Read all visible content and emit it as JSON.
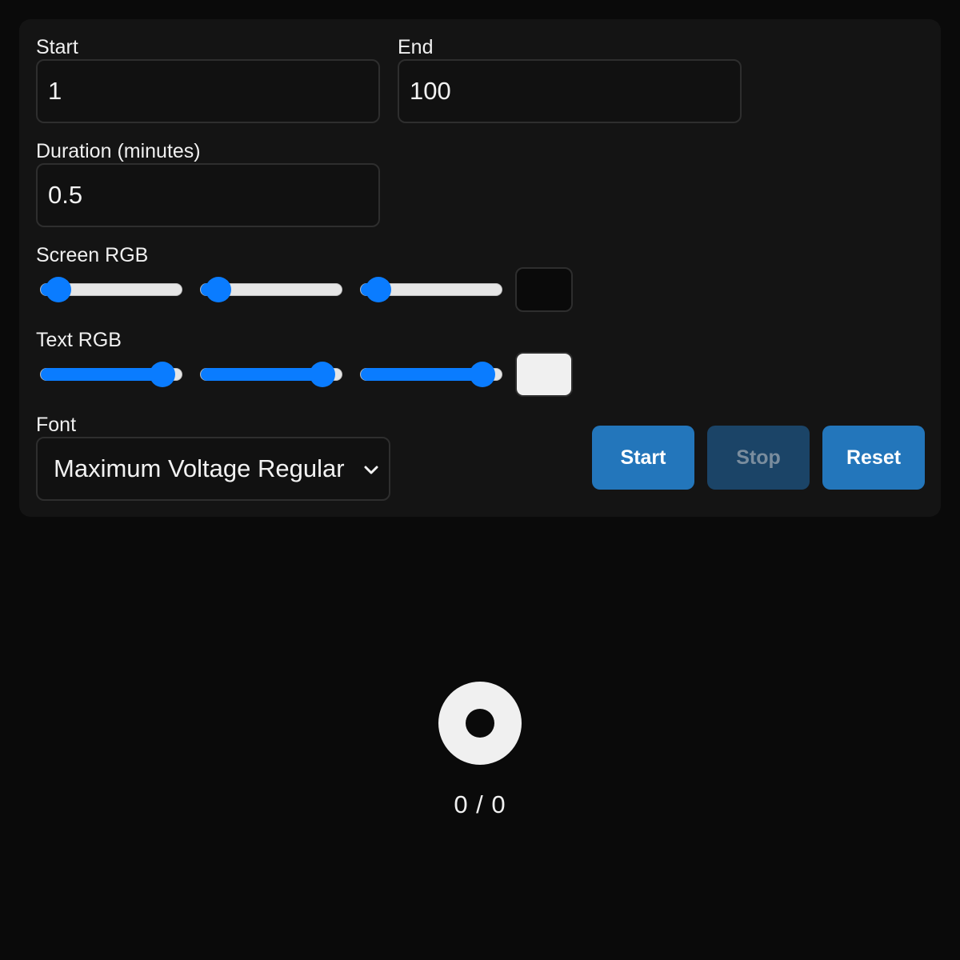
{
  "form": {
    "start": {
      "label": "Start",
      "value": "1"
    },
    "end": {
      "label": "End",
      "value": "100"
    },
    "duration": {
      "label": "Duration (minutes)",
      "value": "0.5"
    },
    "screen_rgb": {
      "label": "Screen RGB",
      "r": 10,
      "g": 10,
      "b": 10,
      "max": 255,
      "swatch_color": "#0a0a0a"
    },
    "text_rgb": {
      "label": "Text RGB",
      "r": 240,
      "g": 240,
      "b": 240,
      "max": 255,
      "swatch_color": "#f0f0f0"
    },
    "font": {
      "label": "Font",
      "selected": "Maximum Voltage Regular"
    }
  },
  "buttons": {
    "start_label": "Start",
    "stop_label": "Stop",
    "reset_label": "Reset"
  },
  "display": {
    "counter": "0 / 0"
  },
  "colors": {
    "accent": "#0a7cff",
    "button": "#2376bb",
    "button_disabled": "#1b4467",
    "background": "#0a0a0a",
    "panel": "#141414"
  }
}
